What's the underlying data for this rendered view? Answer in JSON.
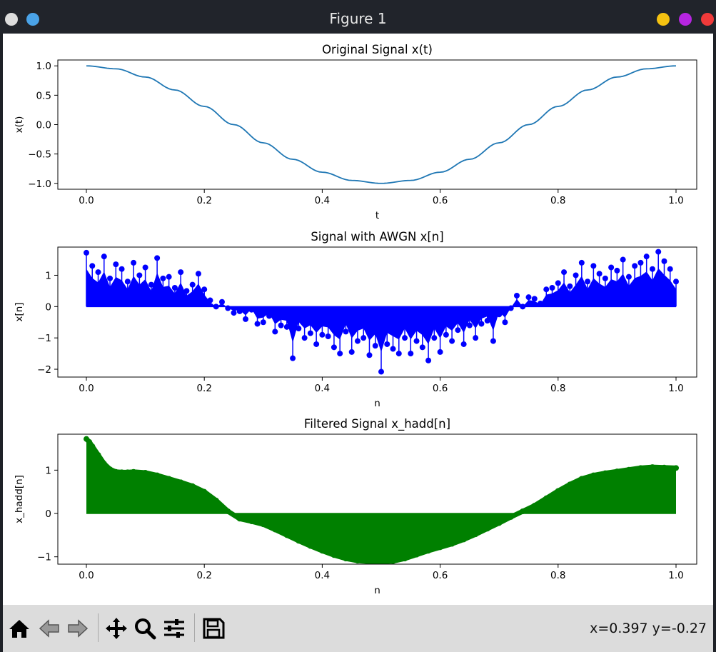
{
  "window": {
    "title": "Figure 1",
    "buttons": [
      {
        "name": "minimize",
        "color": "#f5c211"
      },
      {
        "name": "maximize",
        "color": "#b625e0"
      },
      {
        "name": "close",
        "color": "#f03a3a"
      }
    ]
  },
  "toolbar": {
    "buttons": [
      "home-icon",
      "back-icon",
      "forward-icon",
      "pan-icon",
      "zoom-icon",
      "configure-subplots-icon",
      "save-icon"
    ],
    "coords": "x=0.397 y=-0.27"
  },
  "chart_data": [
    {
      "type": "line",
      "title": "Original Signal x(t)",
      "xlabel": "t",
      "ylabel": "x(t)",
      "xlim": [
        0.0,
        1.0
      ],
      "ylim": [
        -1.1,
        1.1
      ],
      "xticks": [
        "0.0",
        "0.2",
        "0.4",
        "0.6",
        "0.8",
        "1.0"
      ],
      "yticks": [
        "1.0",
        "0.5",
        "0.0",
        "−0.5",
        "−1.0"
      ],
      "color": "#1f77b4",
      "series": [
        {
          "x": [
            0.0,
            0.05,
            0.1,
            0.15,
            0.2,
            0.25,
            0.3,
            0.35,
            0.4,
            0.45,
            0.5,
            0.55,
            0.6,
            0.65,
            0.7,
            0.75,
            0.8,
            0.85,
            0.9,
            0.95,
            1.0
          ],
          "y": [
            1.0,
            0.95,
            0.81,
            0.59,
            0.31,
            0.0,
            -0.31,
            -0.59,
            -0.81,
            -0.95,
            -1.0,
            -0.95,
            -0.81,
            -0.59,
            -0.31,
            0.0,
            0.31,
            0.59,
            0.81,
            0.95,
            1.0
          ]
        }
      ]
    },
    {
      "type": "stem",
      "title": "Signal with AWGN x[n]",
      "xlabel": "n",
      "ylabel": "x[n]",
      "xlim": [
        0.0,
        1.0
      ],
      "ylim": [
        -2.25,
        1.9
      ],
      "xticks": [
        "0.0",
        "0.2",
        "0.4",
        "0.6",
        "0.8",
        "1.0"
      ],
      "yticks": [
        "1",
        "0",
        "−1",
        "−2"
      ],
      "color": "#0000ff",
      "series": [
        {
          "x": [
            0.0,
            0.01,
            0.02,
            0.03,
            0.04,
            0.05,
            0.06,
            0.07,
            0.08,
            0.09,
            0.1,
            0.11,
            0.12,
            0.13,
            0.14,
            0.15,
            0.16,
            0.17,
            0.18,
            0.19,
            0.2,
            0.21,
            0.22,
            0.23,
            0.24,
            0.25,
            0.26,
            0.27,
            0.28,
            0.29,
            0.3,
            0.31,
            0.32,
            0.33,
            0.34,
            0.35,
            0.36,
            0.37,
            0.38,
            0.39,
            0.4,
            0.41,
            0.42,
            0.43,
            0.44,
            0.45,
            0.46,
            0.47,
            0.48,
            0.49,
            0.5,
            0.51,
            0.52,
            0.53,
            0.54,
            0.55,
            0.56,
            0.57,
            0.58,
            0.59,
            0.6,
            0.61,
            0.62,
            0.63,
            0.64,
            0.65,
            0.66,
            0.67,
            0.68,
            0.69,
            0.7,
            0.71,
            0.72,
            0.73,
            0.74,
            0.75,
            0.76,
            0.77,
            0.78,
            0.79,
            0.8,
            0.81,
            0.82,
            0.83,
            0.84,
            0.85,
            0.86,
            0.87,
            0.88,
            0.89,
            0.9,
            0.91,
            0.92,
            0.93,
            0.94,
            0.95,
            0.96,
            0.97,
            0.98,
            0.99,
            1.0
          ],
          "y": [
            1.72,
            1.3,
            1.1,
            1.6,
            0.9,
            1.35,
            1.2,
            0.8,
            1.4,
            1.0,
            1.25,
            0.7,
            1.55,
            0.9,
            0.95,
            0.6,
            1.1,
            0.5,
            0.7,
            1.05,
            0.55,
            0.2,
            0.0,
            0.15,
            -0.05,
            -0.2,
            -0.15,
            -0.4,
            -0.1,
            -0.55,
            -0.5,
            -0.3,
            -0.8,
            -0.6,
            -0.65,
            -1.65,
            -0.7,
            -1.0,
            -0.85,
            -1.2,
            -0.9,
            -0.95,
            -1.3,
            -1.5,
            -0.8,
            -1.45,
            -1.1,
            -1.0,
            -1.55,
            -1.25,
            -2.08,
            -1.2,
            -1.35,
            -1.5,
            -1.0,
            -1.5,
            -1.1,
            -1.3,
            -1.72,
            -1.0,
            -1.45,
            -0.9,
            -1.1,
            -0.75,
            -1.2,
            -0.6,
            -1.0,
            -0.55,
            -0.45,
            -1.1,
            -0.25,
            -0.5,
            -0.05,
            0.35,
            0.0,
            0.3,
            0.25,
            0.1,
            0.55,
            0.6,
            0.75,
            1.1,
            0.65,
            1.0,
            1.4,
            0.8,
            1.3,
            1.05,
            0.9,
            1.25,
            1.15,
            1.5,
            0.95,
            1.3,
            1.4,
            1.6,
            1.2,
            1.75,
            1.45,
            1.2,
            0.8
          ]
        }
      ]
    },
    {
      "type": "stem",
      "title": "Filtered Signal x_hadd[n]",
      "xlabel": "n",
      "ylabel": "x_hadd[n]",
      "xlim": [
        0.0,
        1.0
      ],
      "ylim": [
        -1.17,
        1.83
      ],
      "xticks": [
        "0.0",
        "0.2",
        "0.4",
        "0.6",
        "0.8",
        "1.0"
      ],
      "yticks": [
        "1",
        "0",
        "−1"
      ],
      "color": "#008000",
      "series": [
        {
          "x": [
            0.0,
            0.005,
            0.01,
            0.02,
            0.03,
            0.04,
            0.05,
            0.06,
            0.07,
            0.08,
            0.1,
            0.12,
            0.14,
            0.16,
            0.18,
            0.2,
            0.22,
            0.24,
            0.26,
            0.28,
            0.3,
            0.32,
            0.34,
            0.36,
            0.38,
            0.4,
            0.42,
            0.44,
            0.46,
            0.48,
            0.5,
            0.52,
            0.54,
            0.56,
            0.58,
            0.6,
            0.62,
            0.64,
            0.66,
            0.68,
            0.7,
            0.72,
            0.74,
            0.76,
            0.78,
            0.8,
            0.82,
            0.84,
            0.86,
            0.88,
            0.9,
            0.92,
            0.94,
            0.96,
            0.98,
            1.0
          ],
          "y": [
            1.72,
            1.65,
            1.55,
            1.35,
            1.15,
            1.02,
            0.96,
            0.95,
            0.95,
            0.96,
            0.94,
            0.88,
            0.8,
            0.72,
            0.63,
            0.5,
            0.3,
            0.05,
            -0.12,
            -0.18,
            -0.25,
            -0.37,
            -0.5,
            -0.63,
            -0.75,
            -0.86,
            -0.96,
            -1.04,
            -1.09,
            -1.11,
            -1.11,
            -1.1,
            -1.04,
            -0.95,
            -0.86,
            -0.78,
            -0.7,
            -0.6,
            -0.48,
            -0.35,
            -0.22,
            -0.08,
            0.05,
            0.18,
            0.35,
            0.52,
            0.67,
            0.8,
            0.88,
            0.93,
            0.97,
            1.01,
            1.05,
            1.07,
            1.06,
            1.05
          ]
        }
      ]
    }
  ]
}
